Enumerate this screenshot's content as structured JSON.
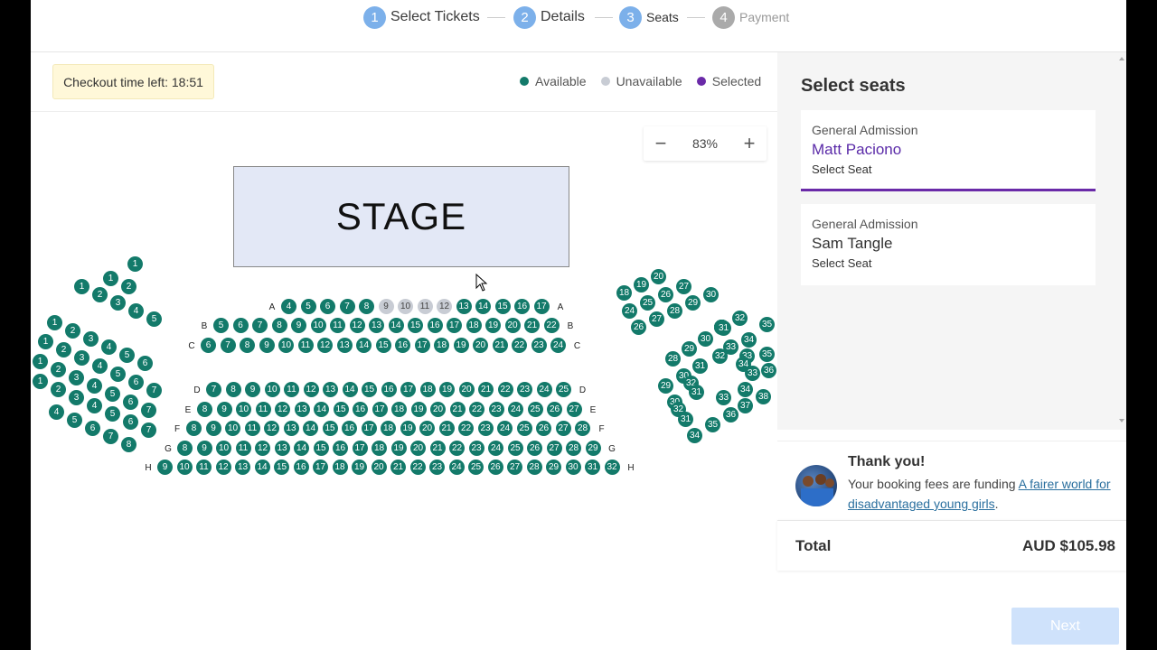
{
  "stepper": {
    "steps": [
      {
        "num": "1",
        "label": "Select Tickets"
      },
      {
        "num": "2",
        "label": "Details"
      },
      {
        "num": "3",
        "label": "Seats"
      },
      {
        "num": "4",
        "label": "Payment"
      }
    ]
  },
  "toolbar": {
    "timer": "Checkout time left: 18:51",
    "legend": [
      {
        "label": "Available",
        "color": "#137a6a"
      },
      {
        "label": "Unavailable",
        "color": "#c8ccd4"
      },
      {
        "label": "Selected",
        "color": "#6a2aa8"
      }
    ]
  },
  "zoom": {
    "minus": "−",
    "value": "83%",
    "plus": "+"
  },
  "stage": {
    "label": "STAGE"
  },
  "panel": {
    "title": "Select seats",
    "cards": [
      {
        "type": "General Admission",
        "name": "Matt Paciono",
        "select": "Select Seat"
      },
      {
        "type": "General Admission",
        "name": "Sam Tangle",
        "select": "Select Seat"
      }
    ]
  },
  "thanks": {
    "title": "Thank you!",
    "text": "Your booking fees are funding ",
    "link": "A fairer world for disadvantaged young girls",
    "suffix": "."
  },
  "total": {
    "label": "Total",
    "amount": "AUD $105.98"
  },
  "next": {
    "label": "Next"
  },
  "seating": {
    "center_rows": [
      {
        "row": "A",
        "first": 4,
        "last": 17,
        "unavailable": [
          9,
          10,
          11,
          12
        ]
      },
      {
        "row": "B",
        "first": 5,
        "last": 22,
        "unavailable": []
      },
      {
        "row": "C",
        "first": 6,
        "last": 24,
        "unavailable": []
      },
      {
        "row": "D",
        "first": 7,
        "last": 25,
        "unavailable": []
      },
      {
        "row": "E",
        "first": 8,
        "last": 27,
        "unavailable": []
      },
      {
        "row": "F",
        "first": 8,
        "last": 28,
        "unavailable": []
      },
      {
        "row": "G",
        "first": 8,
        "last": 29,
        "unavailable": []
      },
      {
        "row": "H",
        "first": 9,
        "last": 32,
        "unavailable": []
      }
    ]
  }
}
